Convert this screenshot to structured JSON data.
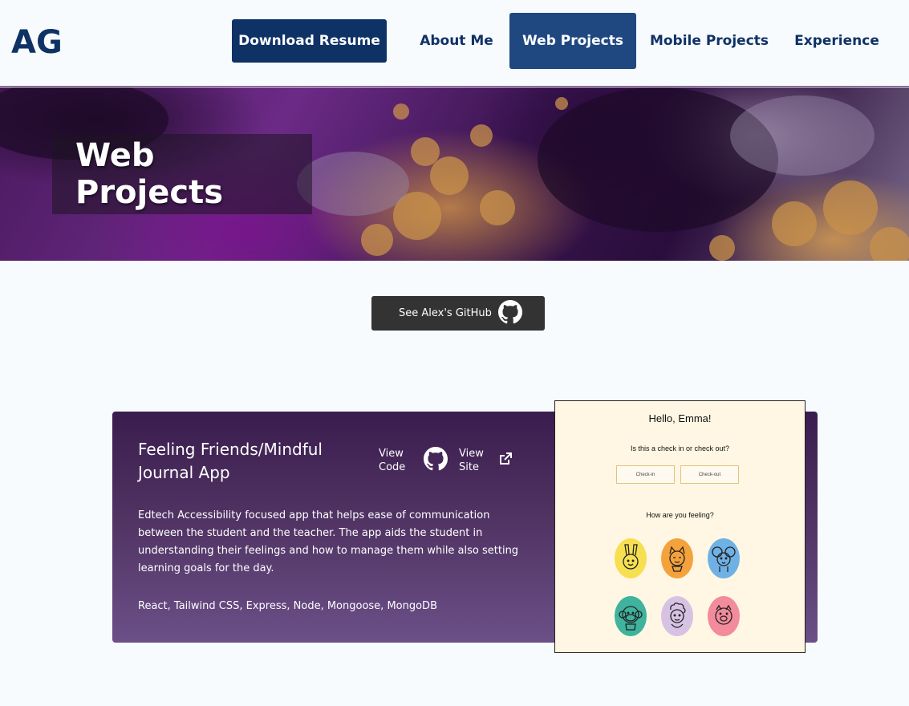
{
  "header": {
    "logo": "AG",
    "resume_button": "Download Resume",
    "nav": [
      "About Me",
      "Web Projects",
      "Mobile Projects",
      "Experience"
    ],
    "active_nav": "Web Projects"
  },
  "hero": {
    "title": "Web Projects"
  },
  "github_button": {
    "label": "See Alex's GitHub",
    "icon": "github-icon"
  },
  "project": {
    "title": "Feeling Friends/Mindful Journal App",
    "view_code": "View Code",
    "view_site": "View Site",
    "description": "Edtech Accessibility focused app that helps ease of communication between the student and the teacher. The app aids the student in understanding their feelings and how to manage them while also setting learning goals for the day.",
    "tech": "React, Tailwind CSS, Express, Node, Mongoose, MongoDB",
    "screenshot": {
      "greeting": "Hello, Emma!",
      "question1": "Is this a check in or check out?",
      "check_in": "Check-in",
      "check_out": "Check-out",
      "question2": "How are you feeling?",
      "feelings": [
        {
          "icon": "bunny-icon",
          "color": "#f7df52"
        },
        {
          "icon": "cat-icon",
          "color": "#f4a23c"
        },
        {
          "icon": "mouse-icon",
          "color": "#6fb1e4"
        },
        {
          "icon": "monkey-icon",
          "color": "#3fb39d"
        },
        {
          "icon": "sheep-icon",
          "color": "#d7c2e4"
        },
        {
          "icon": "pig-icon",
          "color": "#f28b9b"
        }
      ]
    }
  },
  "colors": {
    "brand": "#0f3266",
    "active_nav": "#1f4880",
    "background": "#f7fbfd",
    "github_button": "#333333"
  }
}
